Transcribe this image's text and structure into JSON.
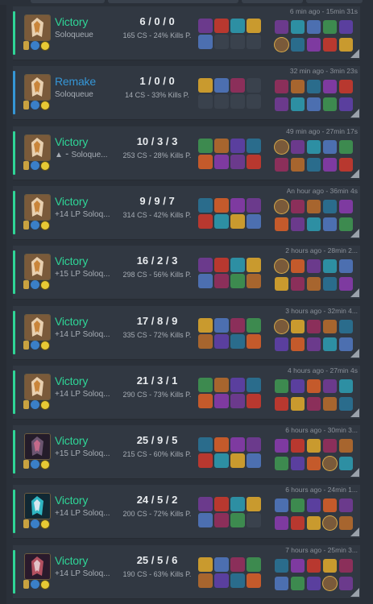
{
  "colors": {
    "victory": "#2fd597",
    "remake": "#3596d6",
    "background": "#2a3039",
    "row": "#313842"
  },
  "matches": [
    {
      "result": "Victory",
      "queue": "Soloqueue",
      "kda": "6 / 0 / 0",
      "stats": "165 CS - 24% Kills P.",
      "time": "6 min ago - 15min 31s",
      "champion_icon": "champion-portrait-icon"
    },
    {
      "result": "Remake",
      "queue": "Soloqueue",
      "kda": "1 / 0 / 0",
      "stats": "14 CS - 33% Kills P.",
      "time": "32 min ago - 3min 23s",
      "champion_icon": "champion-portrait-icon"
    },
    {
      "result": "Victory",
      "queue": "▲ ⁃ Soloque...",
      "kda": "10 / 3 / 3",
      "stats": "253 CS - 28% Kills P.",
      "time": "49 min ago - 27min 17s",
      "champion_icon": "champion-portrait-icon"
    },
    {
      "result": "Victory",
      "queue": "+14 LP Soloq...",
      "kda": "9 / 9 / 7",
      "stats": "314 CS - 42% Kills P.",
      "time": "An hour ago - 36min 4s",
      "champion_icon": "champion-portrait-icon"
    },
    {
      "result": "Victory",
      "queue": "+15 LP Soloq...",
      "kda": "16 / 2 / 3",
      "stats": "298 CS - 56% Kills P.",
      "time": "2 hours ago - 28min 2...",
      "champion_icon": "champion-portrait-icon"
    },
    {
      "result": "Victory",
      "queue": "+14 LP Soloq...",
      "kda": "17 / 8 / 9",
      "stats": "335 CS - 72% Kills P.",
      "time": "3 hours ago - 32min 4...",
      "champion_icon": "champion-portrait-icon"
    },
    {
      "result": "Victory",
      "queue": "+14 LP Soloq...",
      "kda": "21 / 3 / 1",
      "stats": "290 CS - 73% Kills P.",
      "time": "4 hours ago - 27min 4s",
      "champion_icon": "champion-portrait-icon"
    },
    {
      "result": "Victory",
      "queue": "+15 LP Soloq...",
      "kda": "25 / 9 / 5",
      "stats": "215 CS - 60% Kills P.",
      "time": "6 hours ago - 30min 3...",
      "champion_icon": "champion-portrait-icon"
    },
    {
      "result": "Victory",
      "queue": "+14 LP Soloq...",
      "kda": "24 / 5 / 2",
      "stats": "200 CS - 72% Kills P.",
      "time": "6 hours ago - 24min 1...",
      "champion_icon": "champion-portrait-icon"
    },
    {
      "result": "Victory",
      "queue": "+14 LP Soloq...",
      "kda": "25 / 5 / 6",
      "stats": "190 CS - 63% Kills P.",
      "time": "7 hours ago - 25min 3...",
      "champion_icon": "champion-portrait-icon"
    }
  ]
}
